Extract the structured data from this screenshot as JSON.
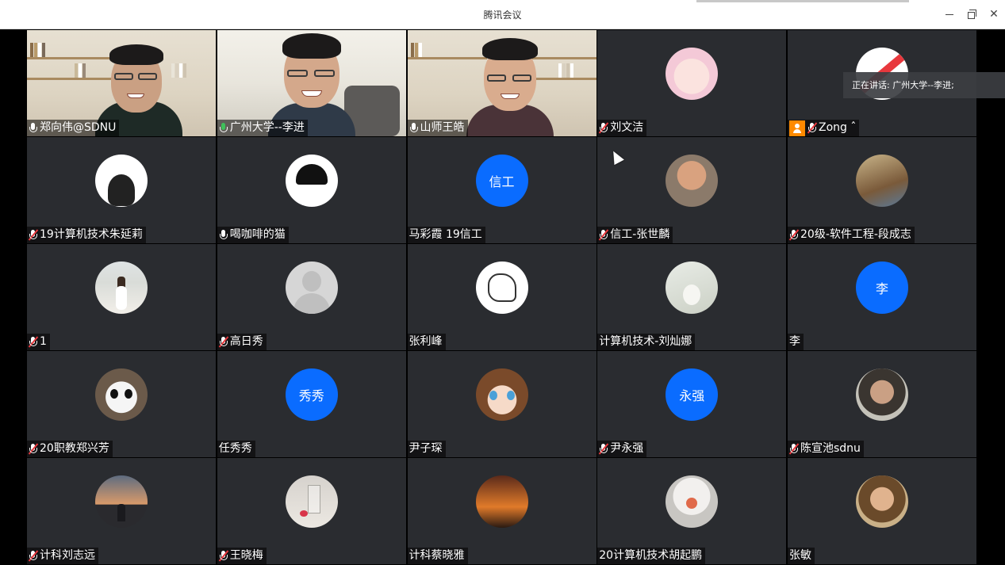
{
  "window": {
    "title": "腾讯会议",
    "controls": {
      "minimize": "minimize",
      "maximize": "restore",
      "close": "✕"
    }
  },
  "speaking_toast": "正在讲话: 广州大学--李进;",
  "colors": {
    "avatar_blue": "#0a6cff",
    "active_border": "#3aa35a",
    "tile_bg": "#2a2c30",
    "host_badge": "#ff8a00",
    "muted_red": "#e8383d"
  },
  "participants": [
    {
      "name": "郑向伟@SDNU",
      "mic": "on",
      "type": "video"
    },
    {
      "name": "广州大学--李进",
      "mic": "talking",
      "type": "video",
      "active": true
    },
    {
      "name": "山师王皓",
      "mic": "on",
      "type": "video"
    },
    {
      "name": "刘文洁",
      "mic": "muted",
      "type": "avatar",
      "avatar_icon": "anime-pink-avatar"
    },
    {
      "name": "Zong ˆ",
      "mic": "muted",
      "type": "avatar",
      "host": true,
      "avatar_icon": "zong-avatar"
    },
    {
      "name": "19计算机技术朱延莉",
      "mic": "muted",
      "type": "avatar",
      "avatar_icon": "bw-masked-avatar"
    },
    {
      "name": "喝咖啡的猫",
      "mic": "on",
      "type": "avatar",
      "avatar_icon": "bw-girl-avatar"
    },
    {
      "name": "马彩霞  19信工",
      "mic": "none",
      "type": "text-avatar",
      "avatar_text": "信工"
    },
    {
      "name": "信工-张世麟",
      "mic": "muted",
      "type": "avatar",
      "avatar_icon": "bodybuilder-avatar"
    },
    {
      "name": "20级-软件工程-段成志",
      "mic": "muted",
      "type": "avatar",
      "avatar_icon": "napoleon-avatar"
    },
    {
      "name": "1",
      "mic": "muted",
      "type": "avatar",
      "avatar_icon": "girl-photo-avatar"
    },
    {
      "name": "高日秀",
      "mic": "muted",
      "type": "avatar",
      "avatar_icon": "default-avatar"
    },
    {
      "name": "张利峰",
      "mic": "none",
      "type": "avatar",
      "avatar_icon": "dinosaur-avatar"
    },
    {
      "name": "计算机技术-刘灿娜",
      "mic": "none",
      "type": "avatar",
      "avatar_icon": "rabbit-photo-avatar"
    },
    {
      "name": "李",
      "mic": "none",
      "type": "text-avatar",
      "avatar_text": "李"
    },
    {
      "name": "20职教郑兴芳",
      "mic": "muted",
      "type": "avatar",
      "avatar_icon": "panda-avatar"
    },
    {
      "name": "任秀秀",
      "mic": "none",
      "type": "text-avatar",
      "avatar_text": "秀秀"
    },
    {
      "name": "尹子琛",
      "mic": "none",
      "type": "avatar",
      "avatar_icon": "anime-girl-avatar"
    },
    {
      "name": "尹永强",
      "mic": "muted",
      "type": "text-avatar",
      "avatar_text": "永强"
    },
    {
      "name": "陈宣池sdnu",
      "mic": "muted",
      "type": "avatar",
      "avatar_icon": "man-photo-avatar"
    },
    {
      "name": "计科刘志远",
      "mic": "muted",
      "type": "avatar",
      "avatar_icon": "sunset-avatar"
    },
    {
      "name": "王晓梅",
      "mic": "muted",
      "type": "avatar",
      "avatar_icon": "glass-rose-avatar"
    },
    {
      "name": "计科蔡晓雅",
      "mic": "none",
      "type": "avatar",
      "avatar_icon": "film-scene-avatar"
    },
    {
      "name": "20计算机技术胡起鹏",
      "mic": "none",
      "type": "avatar",
      "avatar_icon": "noodle-avatar"
    },
    {
      "name": "张敏",
      "mic": "none",
      "type": "avatar",
      "avatar_icon": "painting-avatar"
    }
  ]
}
